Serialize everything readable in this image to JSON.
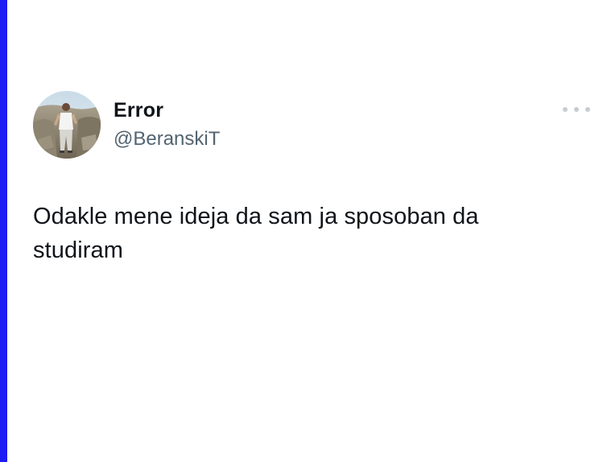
{
  "tweet": {
    "author": {
      "display_name": "Error",
      "handle": "@BeranskiT",
      "avatar": "profile-photo"
    },
    "text": "Odakle mene ideja da sam ja sposoban da studiram",
    "more_icon": "ellipsis-icon"
  },
  "colors": {
    "left_bar": "#1d1cf2",
    "text_primary": "#0f1419",
    "text_secondary": "#536471",
    "more_dots": "#c5cdd3"
  }
}
